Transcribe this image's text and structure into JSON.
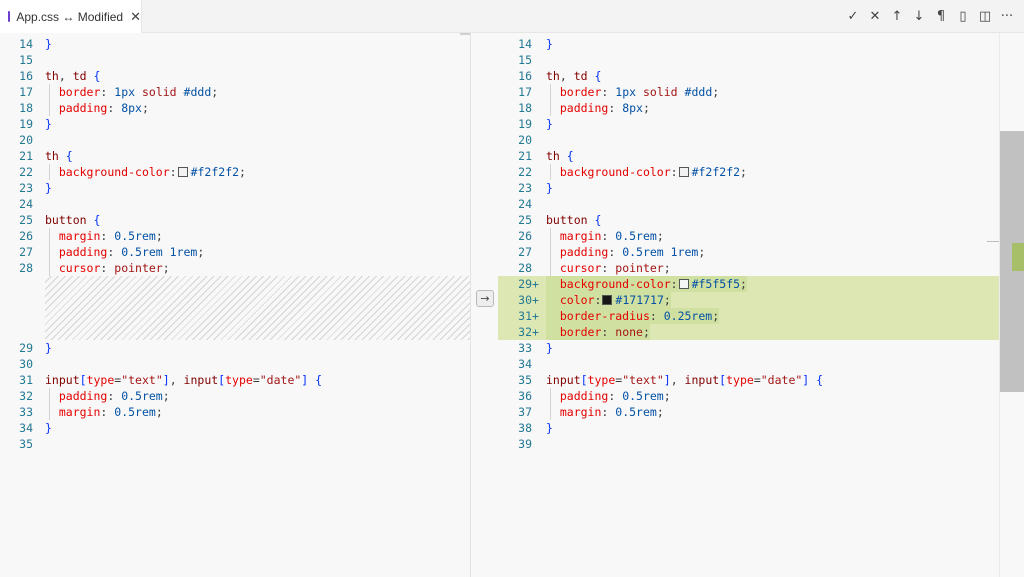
{
  "tab": {
    "icon": "css-file-icon",
    "label": "App.css ↔ Modified",
    "close_glyph": "✕"
  },
  "actions": [
    {
      "name": "accept-icon",
      "glyph": "✓"
    },
    {
      "name": "discard-icon",
      "glyph": "✕"
    },
    {
      "name": "arrow-up-icon",
      "glyph": "↑"
    },
    {
      "name": "arrow-down-icon",
      "glyph": "↓"
    },
    {
      "name": "pilcrow-icon",
      "glyph": "¶"
    },
    {
      "name": "map-icon",
      "glyph": "▯"
    },
    {
      "name": "split-editor-icon",
      "glyph": "◫"
    },
    {
      "name": "more-icon",
      "glyph": "···"
    }
  ],
  "gutter_glyph": "→",
  "left_lines": [
    {
      "n": "14",
      "t": [
        [
          "brace",
          "}"
        ]
      ]
    },
    {
      "n": "15",
      "t": []
    },
    {
      "n": "16",
      "t": [
        [
          "sel",
          "th"
        ],
        [
          "punc",
          ", "
        ],
        [
          "sel",
          "td"
        ],
        [
          "punc",
          " "
        ],
        [
          "brace",
          "{"
        ]
      ]
    },
    {
      "n": "17",
      "g": true,
      "t": [
        [
          "punc",
          "  "
        ],
        [
          "prop",
          "border"
        ],
        [
          "punc",
          ": "
        ],
        [
          "val",
          "1px"
        ],
        [
          "punc",
          " "
        ],
        [
          "str",
          "solid"
        ],
        [
          "punc",
          " "
        ],
        [
          "val",
          "#ddd"
        ],
        [
          "punc",
          ";"
        ]
      ]
    },
    {
      "n": "18",
      "g": true,
      "t": [
        [
          "punc",
          "  "
        ],
        [
          "prop",
          "padding"
        ],
        [
          "punc",
          ": "
        ],
        [
          "val",
          "8px"
        ],
        [
          "punc",
          ";"
        ]
      ]
    },
    {
      "n": "19",
      "t": [
        [
          "brace",
          "}"
        ]
      ]
    },
    {
      "n": "20",
      "t": []
    },
    {
      "n": "21",
      "t": [
        [
          "sel",
          "th"
        ],
        [
          "punc",
          " "
        ],
        [
          "brace",
          "{"
        ]
      ]
    },
    {
      "n": "22",
      "g": true,
      "t": [
        [
          "punc",
          "  "
        ],
        [
          "prop",
          "background-color"
        ],
        [
          "punc",
          ":"
        ],
        [
          "swatch",
          "#f2f2f2"
        ],
        [
          "val",
          "#f2f2f2"
        ],
        [
          "punc",
          ";"
        ]
      ]
    },
    {
      "n": "23",
      "t": [
        [
          "brace",
          "}"
        ]
      ]
    },
    {
      "n": "24",
      "t": []
    },
    {
      "n": "25",
      "t": [
        [
          "sel",
          "button"
        ],
        [
          "punc",
          " "
        ],
        [
          "brace",
          "{"
        ]
      ]
    },
    {
      "n": "26",
      "g": true,
      "t": [
        [
          "punc",
          "  "
        ],
        [
          "prop",
          "margin"
        ],
        [
          "punc",
          ": "
        ],
        [
          "val",
          "0.5rem"
        ],
        [
          "punc",
          ";"
        ]
      ]
    },
    {
      "n": "27",
      "g": true,
      "t": [
        [
          "punc",
          "  "
        ],
        [
          "prop",
          "padding"
        ],
        [
          "punc",
          ": "
        ],
        [
          "val",
          "0.5rem 1rem"
        ],
        [
          "punc",
          ";"
        ]
      ]
    },
    {
      "n": "28",
      "g": true,
      "t": [
        [
          "punc",
          "  "
        ],
        [
          "prop",
          "cursor"
        ],
        [
          "punc",
          ": "
        ],
        [
          "str",
          "pointer"
        ],
        [
          "punc",
          ";"
        ]
      ]
    },
    {
      "filler": 4
    },
    {
      "n": "29",
      "t": [
        [
          "brace",
          "}"
        ]
      ]
    },
    {
      "n": "30",
      "t": []
    },
    {
      "n": "31",
      "t": [
        [
          "sel",
          "input"
        ],
        [
          "brace",
          "["
        ],
        [
          "prop",
          "type"
        ],
        [
          "punc",
          "="
        ],
        [
          "str",
          "\"text\""
        ],
        [
          "brace",
          "]"
        ],
        [
          "punc",
          ", "
        ],
        [
          "sel",
          "input"
        ],
        [
          "brace",
          "["
        ],
        [
          "prop",
          "type"
        ],
        [
          "punc",
          "="
        ],
        [
          "str",
          "\"date\""
        ],
        [
          "brace",
          "]"
        ],
        [
          "punc",
          " "
        ],
        [
          "brace",
          "{"
        ]
      ]
    },
    {
      "n": "32",
      "g": true,
      "t": [
        [
          "punc",
          "  "
        ],
        [
          "prop",
          "padding"
        ],
        [
          "punc",
          ": "
        ],
        [
          "val",
          "0.5rem"
        ],
        [
          "punc",
          ";"
        ]
      ]
    },
    {
      "n": "33",
      "g": true,
      "t": [
        [
          "punc",
          "  "
        ],
        [
          "prop",
          "margin"
        ],
        [
          "punc",
          ": "
        ],
        [
          "val",
          "0.5rem"
        ],
        [
          "punc",
          ";"
        ]
      ]
    },
    {
      "n": "34",
      "t": [
        [
          "brace",
          "}"
        ]
      ]
    },
    {
      "n": "35",
      "t": []
    }
  ],
  "right_lines": [
    {
      "n": "14",
      "t": [
        [
          "brace",
          "}"
        ]
      ]
    },
    {
      "n": "15",
      "t": []
    },
    {
      "n": "16",
      "t": [
        [
          "sel",
          "th"
        ],
        [
          "punc",
          ", "
        ],
        [
          "sel",
          "td"
        ],
        [
          "punc",
          " "
        ],
        [
          "brace",
          "{"
        ]
      ]
    },
    {
      "n": "17",
      "g": true,
      "t": [
        [
          "punc",
          "  "
        ],
        [
          "prop",
          "border"
        ],
        [
          "punc",
          ": "
        ],
        [
          "val",
          "1px"
        ],
        [
          "punc",
          " "
        ],
        [
          "str",
          "solid"
        ],
        [
          "punc",
          " "
        ],
        [
          "val",
          "#ddd"
        ],
        [
          "punc",
          ";"
        ]
      ]
    },
    {
      "n": "18",
      "g": true,
      "t": [
        [
          "punc",
          "  "
        ],
        [
          "prop",
          "padding"
        ],
        [
          "punc",
          ": "
        ],
        [
          "val",
          "8px"
        ],
        [
          "punc",
          ";"
        ]
      ]
    },
    {
      "n": "19",
      "t": [
        [
          "brace",
          "}"
        ]
      ]
    },
    {
      "n": "20",
      "t": []
    },
    {
      "n": "21",
      "t": [
        [
          "sel",
          "th"
        ],
        [
          "punc",
          " "
        ],
        [
          "brace",
          "{"
        ]
      ]
    },
    {
      "n": "22",
      "g": true,
      "t": [
        [
          "punc",
          "  "
        ],
        [
          "prop",
          "background-color"
        ],
        [
          "punc",
          ":"
        ],
        [
          "swatch",
          "#f2f2f2"
        ],
        [
          "val",
          "#f2f2f2"
        ],
        [
          "punc",
          ";"
        ]
      ]
    },
    {
      "n": "23",
      "t": [
        [
          "brace",
          "}"
        ]
      ]
    },
    {
      "n": "24",
      "t": []
    },
    {
      "n": "25",
      "t": [
        [
          "sel",
          "button"
        ],
        [
          "punc",
          " "
        ],
        [
          "brace",
          "{"
        ]
      ]
    },
    {
      "n": "26",
      "g": true,
      "t": [
        [
          "punc",
          "  "
        ],
        [
          "prop",
          "margin"
        ],
        [
          "punc",
          ": "
        ],
        [
          "val",
          "0.5rem"
        ],
        [
          "punc",
          ";"
        ]
      ]
    },
    {
      "n": "27",
      "g": true,
      "t": [
        [
          "punc",
          "  "
        ],
        [
          "prop",
          "padding"
        ],
        [
          "punc",
          ": "
        ],
        [
          "val",
          "0.5rem 1rem"
        ],
        [
          "punc",
          ";"
        ]
      ]
    },
    {
      "n": "28",
      "g": true,
      "t": [
        [
          "punc",
          "  "
        ],
        [
          "prop",
          "cursor"
        ],
        [
          "punc",
          ": "
        ],
        [
          "str",
          "pointer"
        ],
        [
          "punc",
          ";"
        ]
      ]
    },
    {
      "n": "29",
      "added": true,
      "g": true,
      "t": [
        [
          "punc",
          "  "
        ],
        [
          "prop",
          "background-color"
        ],
        [
          "punc",
          ":"
        ],
        [
          "swatch",
          "#f5f5f5"
        ],
        [
          "val",
          "#f5f5f5"
        ],
        [
          "punc",
          ";"
        ]
      ]
    },
    {
      "n": "30",
      "added": true,
      "g": true,
      "t": [
        [
          "punc",
          "  "
        ],
        [
          "prop",
          "color"
        ],
        [
          "punc",
          ":"
        ],
        [
          "swatch",
          "#171717"
        ],
        [
          "val",
          "#171717"
        ],
        [
          "punc",
          ";"
        ]
      ]
    },
    {
      "n": "31",
      "added": true,
      "g": true,
      "t": [
        [
          "punc",
          "  "
        ],
        [
          "prop",
          "border-radius"
        ],
        [
          "punc",
          ": "
        ],
        [
          "val",
          "0.25rem"
        ],
        [
          "punc",
          ";"
        ]
      ]
    },
    {
      "n": "32",
      "added": true,
      "g": true,
      "t": [
        [
          "punc",
          "  "
        ],
        [
          "prop",
          "border"
        ],
        [
          "punc",
          ": "
        ],
        [
          "str",
          "none"
        ],
        [
          "punc",
          ";"
        ]
      ]
    },
    {
      "n": "33",
      "t": [
        [
          "brace",
          "}"
        ]
      ]
    },
    {
      "n": "34",
      "t": []
    },
    {
      "n": "35",
      "t": [
        [
          "sel",
          "input"
        ],
        [
          "brace",
          "["
        ],
        [
          "prop",
          "type"
        ],
        [
          "punc",
          "="
        ],
        [
          "str",
          "\"text\""
        ],
        [
          "brace",
          "]"
        ],
        [
          "punc",
          ", "
        ],
        [
          "sel",
          "input"
        ],
        [
          "brace",
          "["
        ],
        [
          "prop",
          "type"
        ],
        [
          "punc",
          "="
        ],
        [
          "str",
          "\"date\""
        ],
        [
          "brace",
          "]"
        ],
        [
          "punc",
          " "
        ],
        [
          "brace",
          "{"
        ]
      ]
    },
    {
      "n": "36",
      "g": true,
      "t": [
        [
          "punc",
          "  "
        ],
        [
          "prop",
          "padding"
        ],
        [
          "punc",
          ": "
        ],
        [
          "val",
          "0.5rem"
        ],
        [
          "punc",
          ";"
        ]
      ]
    },
    {
      "n": "37",
      "g": true,
      "t": [
        [
          "punc",
          "  "
        ],
        [
          "prop",
          "margin"
        ],
        [
          "punc",
          ": "
        ],
        [
          "val",
          "0.5rem"
        ],
        [
          "punc",
          ";"
        ]
      ]
    },
    {
      "n": "38",
      "t": [
        [
          "brace",
          "}"
        ]
      ]
    },
    {
      "n": "39",
      "t": []
    }
  ],
  "added_marker": "+",
  "colors": {
    "added_line": "#dde7b3",
    "added_text": "#cfe0a0",
    "line_number": "#237893",
    "overview_added": "#a8bf6a"
  }
}
